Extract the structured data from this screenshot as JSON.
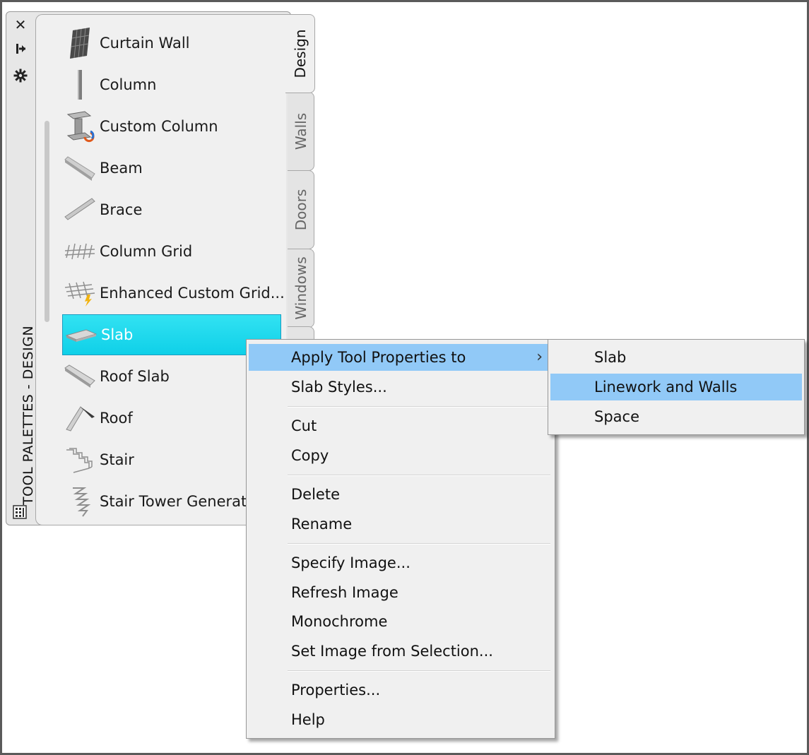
{
  "palette": {
    "title": "TOOL PALETTES - DESIGN",
    "tabs": [
      {
        "label": "Design",
        "active": true
      },
      {
        "label": "Walls",
        "active": false
      },
      {
        "label": "Doors",
        "active": false
      },
      {
        "label": "Windows",
        "active": false
      }
    ],
    "tools": [
      {
        "label": "Curtain Wall",
        "icon": "curtain-wall-icon"
      },
      {
        "label": "Column",
        "icon": "column-icon"
      },
      {
        "label": "Custom Column",
        "icon": "custom-column-icon"
      },
      {
        "label": "Beam",
        "icon": "beam-icon"
      },
      {
        "label": "Brace",
        "icon": "brace-icon"
      },
      {
        "label": "Column Grid",
        "icon": "column-grid-icon"
      },
      {
        "label": "Enhanced  Custom  Grid...",
        "icon": "enhanced-custom-grid-icon"
      },
      {
        "label": "Slab",
        "icon": "slab-icon",
        "selected": true
      },
      {
        "label": "Roof Slab",
        "icon": "roof-slab-icon"
      },
      {
        "label": "Roof",
        "icon": "roof-icon"
      },
      {
        "label": "Stair",
        "icon": "stair-icon"
      },
      {
        "label": "Stair Tower Generate",
        "icon": "stair-tower-icon"
      }
    ]
  },
  "context_menu": {
    "groups": [
      [
        "Apply Tool Properties to",
        "Slab Styles..."
      ],
      [
        "Cut",
        "Copy"
      ],
      [
        "Delete",
        "Rename"
      ],
      [
        "Specify Image...",
        "Refresh Image",
        "Monochrome",
        "Set Image from Selection..."
      ],
      [
        "Properties...",
        "Help"
      ]
    ],
    "highlighted": "Apply Tool Properties to",
    "chevron": "›"
  },
  "submenu": {
    "items": [
      "Slab",
      "Linework and Walls",
      "Space"
    ],
    "highlighted": "Linework and Walls"
  },
  "colors": {
    "selection": "#1fd8ec",
    "menu_highlight": "#91c9f7"
  }
}
